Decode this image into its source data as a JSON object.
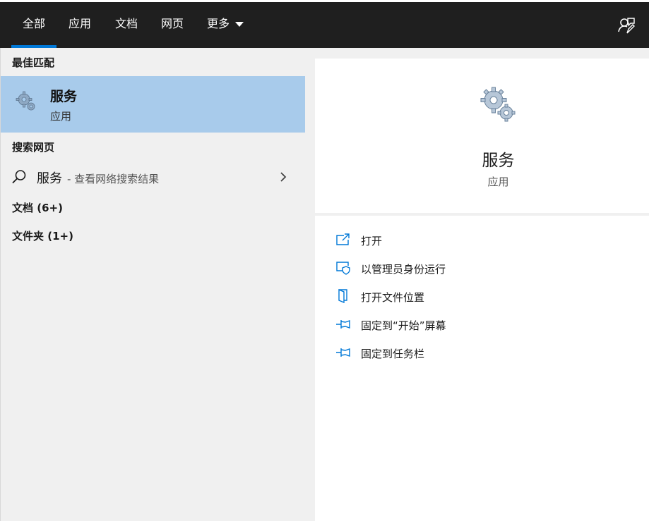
{
  "tabs": [
    {
      "label": "全部",
      "active": true
    },
    {
      "label": "应用"
    },
    {
      "label": "文档"
    },
    {
      "label": "网页"
    },
    {
      "label": "更多"
    }
  ],
  "feedback_icon": "feedback-person-icon",
  "left": {
    "best_match_heading": "最佳匹配",
    "best_match": {
      "name": "服务",
      "type": "应用",
      "icon": "services-gear-icon"
    },
    "search_web_heading": "搜索网页",
    "web_result": {
      "query": "服务",
      "hint": "- 查看网络搜索结果"
    },
    "documents": "文档 (6+)",
    "folders": "文件夹 (1+)"
  },
  "right": {
    "title": "服务",
    "subtitle": "应用",
    "actions": [
      {
        "label": "打开",
        "icon": "open-icon"
      },
      {
        "label": "以管理员身份运行",
        "icon": "run-as-admin-icon"
      },
      {
        "label": "打开文件位置",
        "icon": "file-location-icon"
      },
      {
        "label": "固定到“开始”屏幕",
        "icon": "pin-start-icon"
      },
      {
        "label": "固定到任务栏",
        "icon": "pin-taskbar-icon"
      }
    ]
  },
  "colors": {
    "accent": "#0078d7",
    "selected_bg": "#a8cbeb",
    "tabbar_bg": "#1f1f1f"
  }
}
